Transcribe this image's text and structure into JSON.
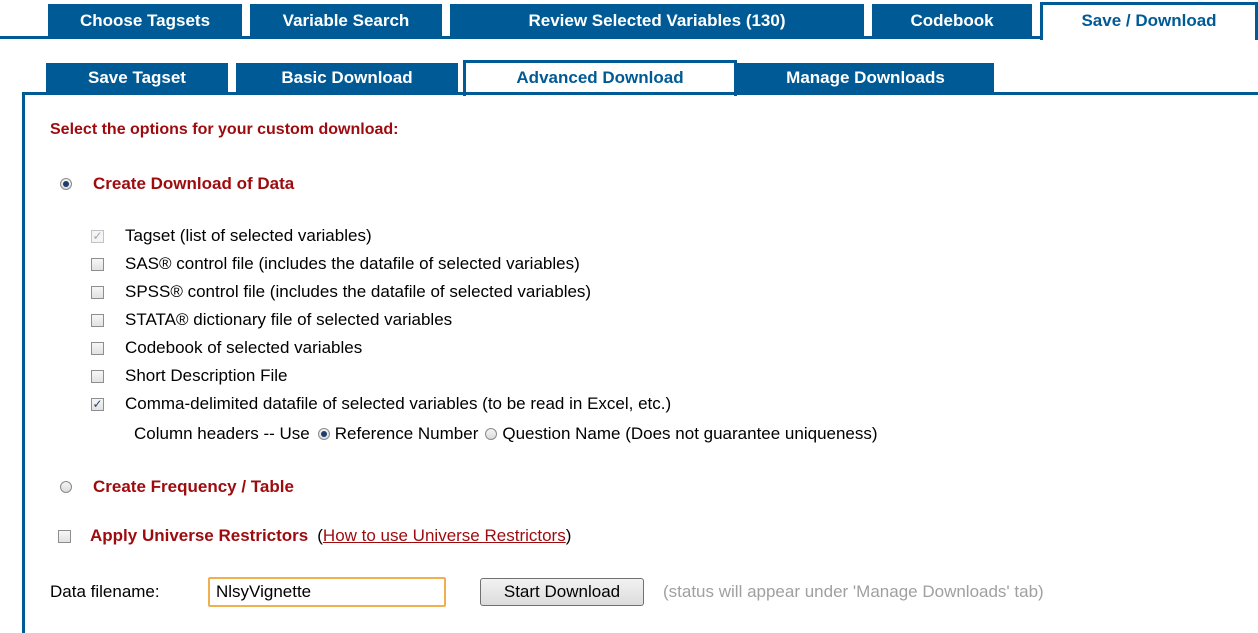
{
  "top_tabs": [
    {
      "label": "Choose Tagsets"
    },
    {
      "label": "Variable Search"
    },
    {
      "label": "Review Selected Variables (130)"
    },
    {
      "label": "Codebook"
    },
    {
      "label": "Save / Download",
      "active": true
    }
  ],
  "sub_tabs": [
    {
      "label": "Save Tagset"
    },
    {
      "label": "Basic Download"
    },
    {
      "label": "Advanced Download",
      "active": true
    },
    {
      "label": "Manage Downloads"
    }
  ],
  "main": {
    "heading": "Select the options for your custom download:",
    "create_download_label": "Create Download of Data",
    "create_download_selected": true,
    "options": [
      {
        "label": "Tagset (list of selected variables)",
        "checked": true,
        "disabled": true
      },
      {
        "label": "SAS® control file (includes the datafile of selected variables)",
        "checked": false
      },
      {
        "label": "SPSS® control file (includes the datafile of selected variables)",
        "checked": false
      },
      {
        "label": "STATA® dictionary file of selected variables",
        "checked": false
      },
      {
        "label": "Codebook of selected variables",
        "checked": false
      },
      {
        "label": "Short Description File",
        "checked": false
      },
      {
        "label": "Comma-delimited datafile of selected variables (to be read in Excel, etc.)",
        "checked": true
      }
    ],
    "column_headers_label": "Column headers -- Use",
    "column_header_options": [
      {
        "label": "Reference Number",
        "selected": true
      },
      {
        "label": "Question Name (Does not guarantee uniqueness)",
        "selected": false
      }
    ],
    "create_frequency_label": "Create Frequency / Table",
    "universe_label": "Apply Universe Restrictors",
    "universe_paren_open": "(",
    "universe_link": "How to use Universe Restrictors",
    "universe_paren_close": ")",
    "filename_label": "Data filename:",
    "filename_value": "NlsyVignette",
    "start_button": "Start Download",
    "status_note": "(status will appear under 'Manage Downloads' tab)"
  },
  "colors": {
    "tab_blue": "#005a96",
    "maroon": "#9e0b0f",
    "note_gray": "#a0a0a0",
    "input_focus": "#f0b050"
  },
  "icons": {
    "checkbox_checked": "✓"
  }
}
